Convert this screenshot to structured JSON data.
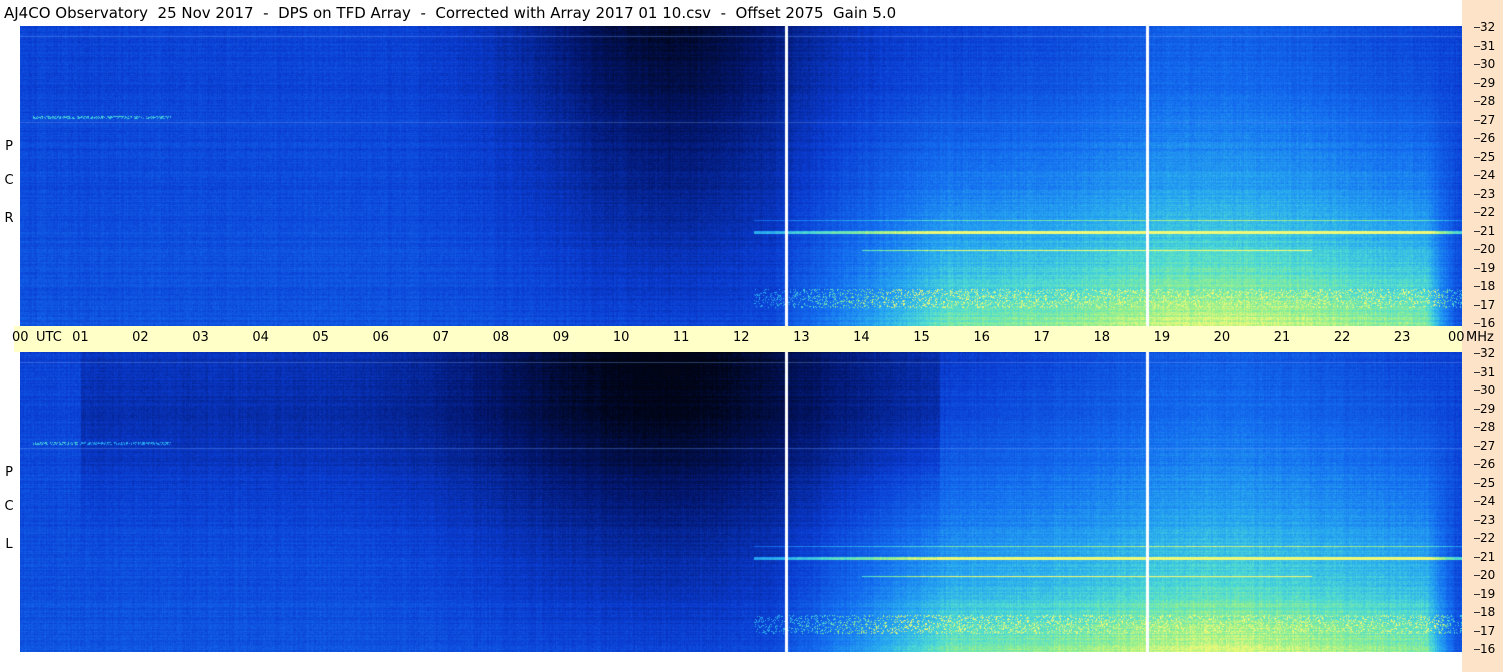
{
  "title": "AJ4CO Observatory  25 Nov 2017  -  DPS on TFD Array  -  Corrected with Array 2017 01 10.csv  -  Offset 2075  Gain 5.0",
  "chart_data": {
    "type": "heatmap",
    "panels": [
      {
        "label": [
          "R",
          "C",
          "P"
        ]
      },
      {
        "label": [
          "L",
          "C",
          "P"
        ]
      }
    ],
    "x_axis": {
      "unit_label": "UTC",
      "ticks": [
        "00",
        "01",
        "02",
        "03",
        "04",
        "05",
        "06",
        "07",
        "08",
        "09",
        "10",
        "11",
        "12",
        "13",
        "14",
        "15",
        "16",
        "17",
        "18",
        "19",
        "20",
        "21",
        "22",
        "23",
        "00"
      ],
      "xlim": [
        0,
        24
      ]
    },
    "y_axis": {
      "unit_label": "MHz",
      "ticks": [
        "32",
        "31",
        "30",
        "29",
        "28",
        "27",
        "26",
        "25",
        "24",
        "23",
        "22",
        "21",
        "20",
        "19",
        "18",
        "17",
        "16"
      ],
      "ylim": [
        16,
        32
      ]
    },
    "vertical_markers_utc": [
      12.75,
      18.75
    ],
    "colors": {
      "background_dark": "#000814",
      "background_blue": "#0a48e6",
      "intense": "#8cf0a0",
      "time_axis_bg": "#ffffc8",
      "freq_axis_bg": "#fde4c8"
    }
  }
}
